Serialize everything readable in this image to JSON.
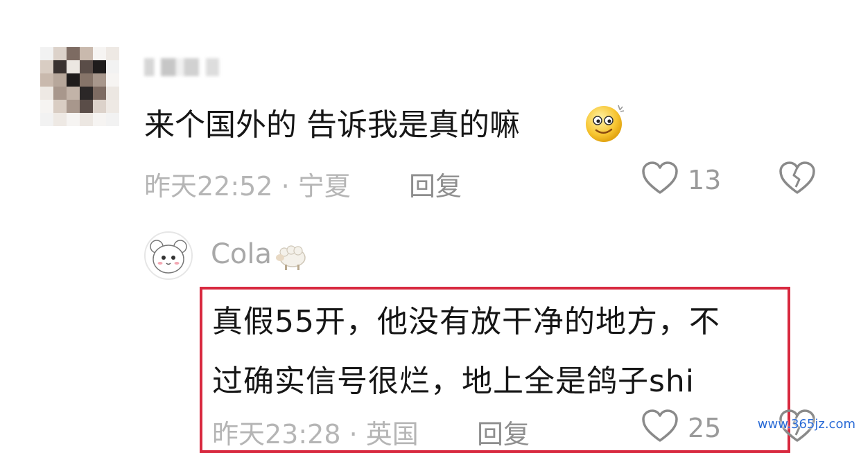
{
  "comment1": {
    "text": "来个国外的 告诉我是真的嘛",
    "emoji": "smiling-face-emoji",
    "time": "昨天22:52",
    "separator": "·",
    "location": "宁夏",
    "reply_label": "回复",
    "likes": "13"
  },
  "comment2": {
    "username": "Cola",
    "username_badge": "sheep-emoji",
    "line1": "真假55开，他没有放干净的地方，不",
    "line2": "过确实信号很烂，地上全是鸽子shi",
    "time": "昨天23:28",
    "separator": "·",
    "location": "英国",
    "reply_label": "回复",
    "likes": "25"
  },
  "watermark": "www.365jz.com",
  "colors": {
    "highlight_border": "#d8293f",
    "meta_gray": "#b5b5b5",
    "watermark_blue": "#2a6bd6"
  }
}
